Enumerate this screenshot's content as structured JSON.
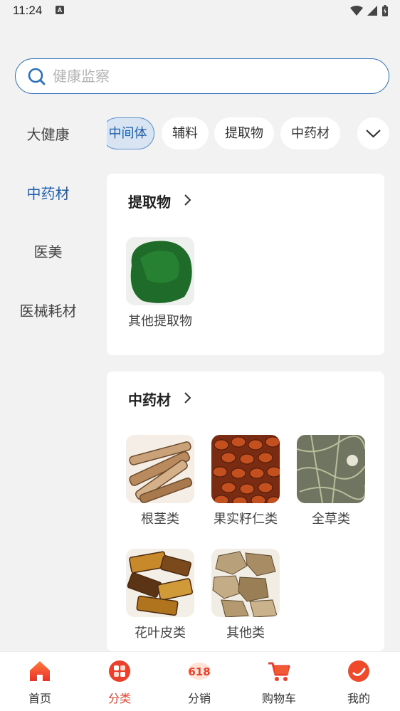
{
  "status": {
    "time": "11:24",
    "a_badge": "A"
  },
  "search": {
    "placeholder": "健康监察"
  },
  "sidebar": {
    "items": [
      {
        "label": "大健康",
        "active": false
      },
      {
        "label": "中药材",
        "active": true
      },
      {
        "label": "医美",
        "active": false
      },
      {
        "label": "医械耗材",
        "active": false
      }
    ]
  },
  "chips": [
    {
      "label": "中间体",
      "active": true
    },
    {
      "label": "辅料",
      "active": false
    },
    {
      "label": "提取物",
      "active": false
    },
    {
      "label": "中药材",
      "active": false
    }
  ],
  "sections": [
    {
      "title": "提取物",
      "items": [
        {
          "label": "其他提取物",
          "icon": "green-powder-image"
        }
      ]
    },
    {
      "title": "中药材",
      "items": [
        {
          "label": "根茎类",
          "icon": "root-slices-image"
        },
        {
          "label": "果实籽仁类",
          "icon": "seeds-image"
        },
        {
          "label": "全草类",
          "icon": "dried-herb-image"
        },
        {
          "label": "花叶皮类",
          "icon": "bark-image"
        },
        {
          "label": "其他类",
          "icon": "dried-slices-image"
        }
      ]
    }
  ],
  "bottom_nav": [
    {
      "label": "首页",
      "icon": "home-icon",
      "active": false
    },
    {
      "label": "分类",
      "icon": "category-icon",
      "active": true
    },
    {
      "label": "分销",
      "icon": "618-icon",
      "active": false
    },
    {
      "label": "购物车",
      "icon": "cart-icon",
      "active": false
    },
    {
      "label": "我的",
      "icon": "profile-icon",
      "active": false
    }
  ],
  "colors": {
    "accent": "#1f5fb0",
    "nav_active": "#e8412e",
    "background": "#f2f2f3"
  }
}
